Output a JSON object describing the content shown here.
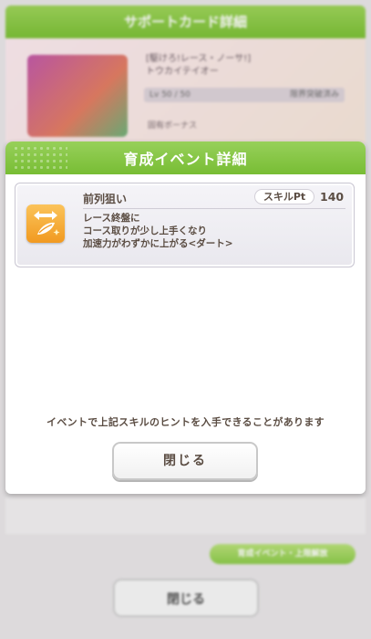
{
  "background": {
    "header_title": "サポートカード詳細",
    "card_name_line1": "[駆けろ!レース・ノーサ!]",
    "card_name_line2": "トウカイテイオー",
    "level_text": "Lv 50 / 50",
    "level_note": "限界突破済み",
    "sub_label": "固有ボーナス",
    "green_button_label": "育成イベント・上限解放",
    "close_label": "閉じる"
  },
  "dialog": {
    "title": "育成イベント詳細",
    "skill": {
      "icon": "speed-up-skill-icon",
      "name": "前列狙い",
      "pt_label": "スキルPt",
      "pt_value": "140",
      "description": [
        "レース終盤に",
        "コース取りが少し上手くなり",
        "加速力がわずかに上がる<ダート>"
      ]
    },
    "notice": "イベントで上記スキルのヒントを入手できることがあります",
    "close_label": "閉じる"
  },
  "colors": {
    "header_green": "#7cc136",
    "text_brown": "#5b4d43",
    "icon_orange": "#f19a21"
  }
}
